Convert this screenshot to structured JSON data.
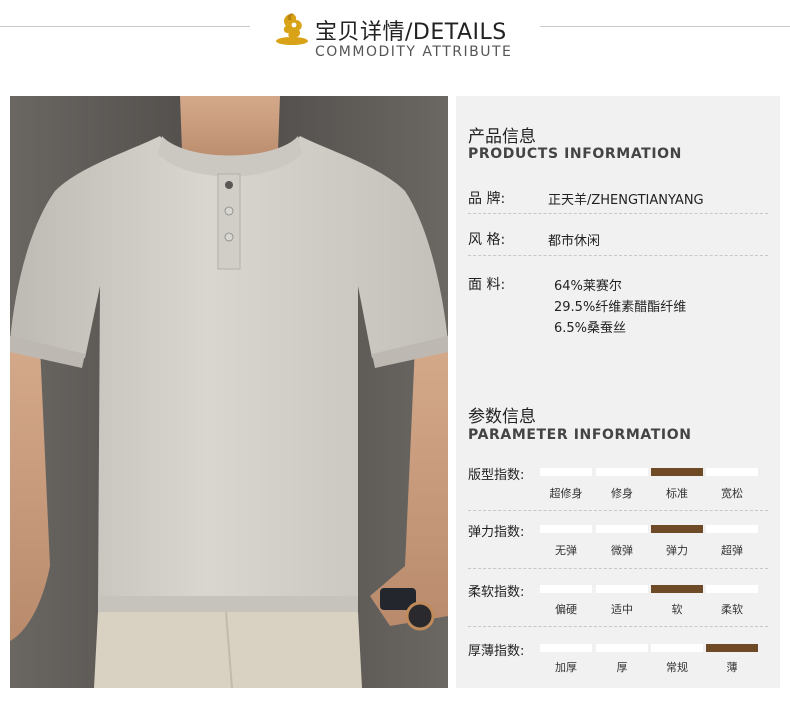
{
  "header": {
    "title": "宝贝详情/DETAILS",
    "subtitle": "COMMODITY ATTRIBUTE"
  },
  "colors": {
    "accent_brown": "#6e4a26",
    "panel_bg": "#f1f1f1",
    "logo_gold": "#d9a318"
  },
  "products": {
    "title": "产品信息",
    "subtitle": "PRODUCTS INFORMATION",
    "brand_label": "品  牌:",
    "brand_value": "正天羊/ZHENGTIANYANG",
    "style_label": "风  格:",
    "style_value": "都市休闲",
    "fabric_label": "面  料:",
    "fabric": [
      "64%莱赛尔",
      "29.5%纤维素醋酯纤维",
      "6.5%桑蚕丝"
    ]
  },
  "parameters": {
    "title": "参数信息",
    "subtitle": "PARAMETER INFORMATION",
    "indices": [
      {
        "label": "版型指数:",
        "options": [
          "超修身",
          "修身",
          "标准",
          "宽松"
        ],
        "selected": 2
      },
      {
        "label": "弹力指数:",
        "options": [
          "无弹",
          "微弹",
          "弹力",
          "超弹"
        ],
        "selected": 2
      },
      {
        "label": "柔软指数:",
        "options": [
          "偏硬",
          "适中",
          "软",
          "柔软"
        ],
        "selected": 2
      },
      {
        "label": "厚薄指数:",
        "options": [
          "加厚",
          "厚",
          "常规",
          "薄"
        ],
        "selected": 3
      }
    ]
  }
}
